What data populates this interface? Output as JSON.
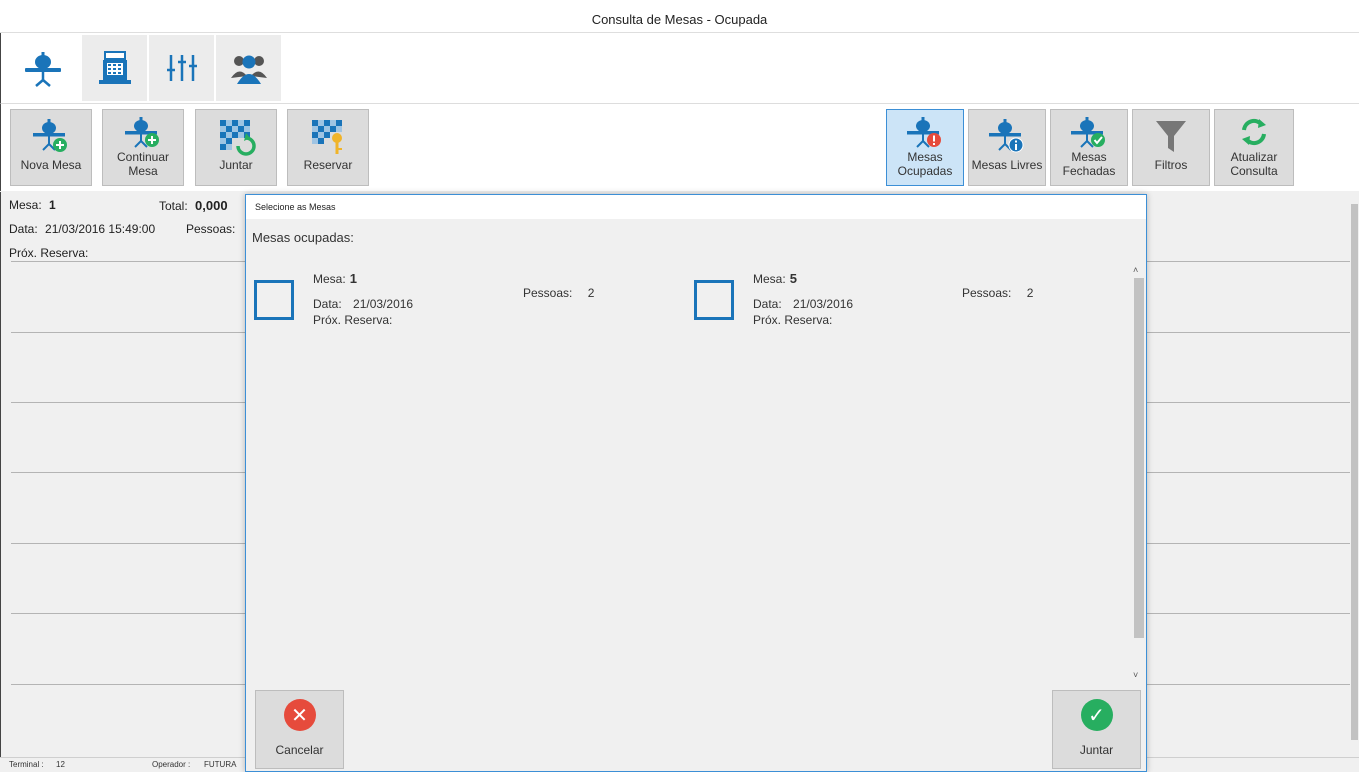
{
  "window": {
    "title": "Consulta de Mesas - Ocupada"
  },
  "tabs": [
    {
      "icon": "table-icon",
      "active": true
    },
    {
      "icon": "cash-register-icon",
      "active": false
    },
    {
      "icon": "sliders-icon",
      "active": false
    },
    {
      "icon": "users-icon",
      "active": false
    }
  ],
  "toolbar": {
    "nova_mesa": "Nova Mesa",
    "continuar_mesa": "Continuar Mesa",
    "juntar": "Juntar",
    "reservar": "Reservar",
    "mesas_ocupadas": "Mesas Ocupadas",
    "mesas_livres": "Mesas Livres",
    "mesas_fechadas": "Mesas Fechadas",
    "filtros": "Filtros",
    "atualizar_consulta": "Atualizar Consulta"
  },
  "left_panel": {
    "mesa_label": "Mesa:",
    "mesa_value": "1",
    "total_label": "Total:",
    "total_value": "0,000",
    "data_label": "Data:",
    "data_value": "21/03/2016  15:49:00",
    "pessoas_label": "Pessoas:",
    "reserva_label": "Próx. Reserva:"
  },
  "status": {
    "terminal_label": "Terminal :",
    "terminal_value": "12",
    "operador_label": "Operador :",
    "operador_value": "FUTURA"
  },
  "dialog": {
    "title": "Selecione as Mesas",
    "subtitle": "Mesas ocupadas:",
    "cards": [
      {
        "mesa_label": "Mesa:",
        "mesa": "1",
        "data_label": "Data:",
        "data": "21/03/2016",
        "reserva_label": "Próx. Reserva:",
        "pessoas_label": "Pessoas:",
        "pessoas": "2"
      },
      {
        "mesa_label": "Mesa:",
        "mesa": "5",
        "data_label": "Data:",
        "data": "21/03/2016",
        "reserva_label": "Próx. Reserva:",
        "pessoas_label": "Pessoas:",
        "pessoas": "2"
      }
    ],
    "cancel_label": "Cancelar",
    "confirm_label": "Juntar"
  },
  "colors": {
    "accent": "#1a74b9",
    "danger": "#e64b3c",
    "success": "#27ae60",
    "selected_bg": "#cce4f7"
  }
}
